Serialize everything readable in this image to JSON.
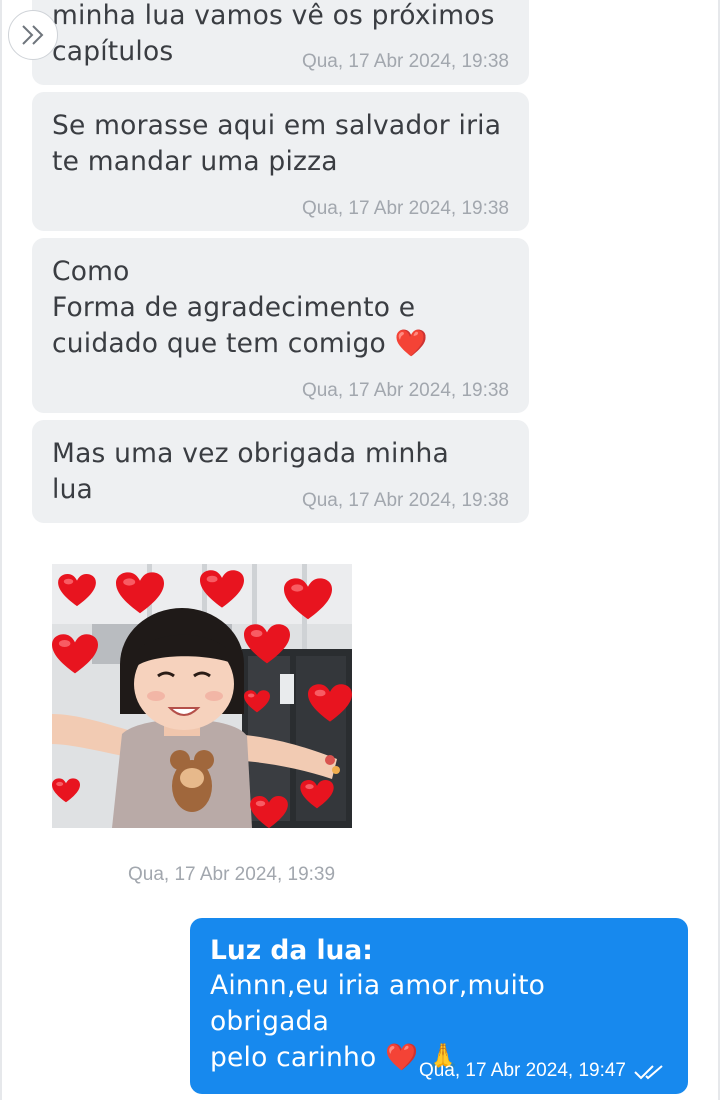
{
  "messages": [
    {
      "text": "minha lua vamos vê os próximos\ncapítulos",
      "time": "Qua, 17 Abr 2024, 19:38"
    },
    {
      "text": "Se morasse aqui em salvador iria\nte mandar uma pizza",
      "time": "Qua, 17 Abr 2024, 19:38"
    },
    {
      "text": "Como\nForma de agradecimento e\ncuidado que tem comigo ",
      "emoji": "❤️",
      "time": "Qua, 17 Abr 2024, 19:38"
    },
    {
      "text": "Mas uma vez obrigada minha\nlua",
      "time": "Qua, 17 Abr 2024, 19:38"
    }
  ],
  "image_message": {
    "time": "Qua, 17 Abr 2024, 19:39"
  },
  "reply": {
    "sender": "Luz da lua:",
    "text": "Ainnn,eu iria amor,muito obrigada\npelo carinho ",
    "emoji": "❤️ 🙏",
    "time": "Qua, 17 Abr 2024, 19:47"
  },
  "icons": {
    "expand": "double-chevron-right-icon",
    "read_status": "double-check-icon"
  },
  "colors": {
    "incoming_bubble": "#eef0f2",
    "outgoing_bubble": "#1789ee",
    "timestamp": "#a2a7ae",
    "text": "#3a3d42"
  }
}
